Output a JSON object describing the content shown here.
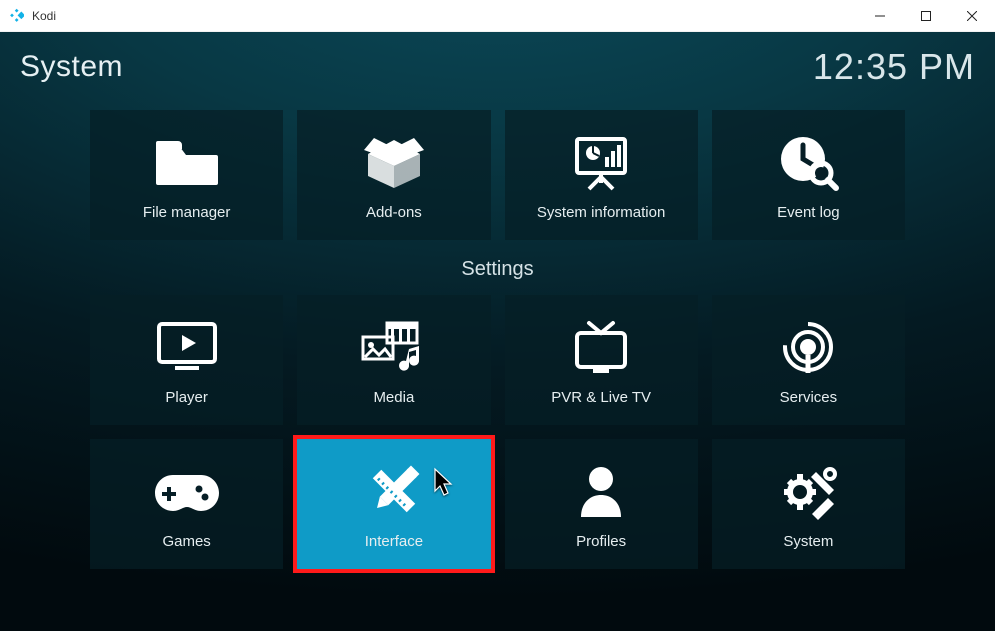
{
  "window": {
    "title": "Kodi"
  },
  "header": {
    "pageTitle": "System",
    "clock": "12:35 PM"
  },
  "section": {
    "label": "Settings"
  },
  "tiles": {
    "row1": [
      {
        "label": "File manager"
      },
      {
        "label": "Add-ons"
      },
      {
        "label": "System information"
      },
      {
        "label": "Event log"
      }
    ],
    "row2": [
      {
        "label": "Player"
      },
      {
        "label": "Media"
      },
      {
        "label": "PVR & Live TV"
      },
      {
        "label": "Services"
      }
    ],
    "row3": [
      {
        "label": "Games"
      },
      {
        "label": "Interface"
      },
      {
        "label": "Profiles"
      },
      {
        "label": "System"
      }
    ]
  }
}
